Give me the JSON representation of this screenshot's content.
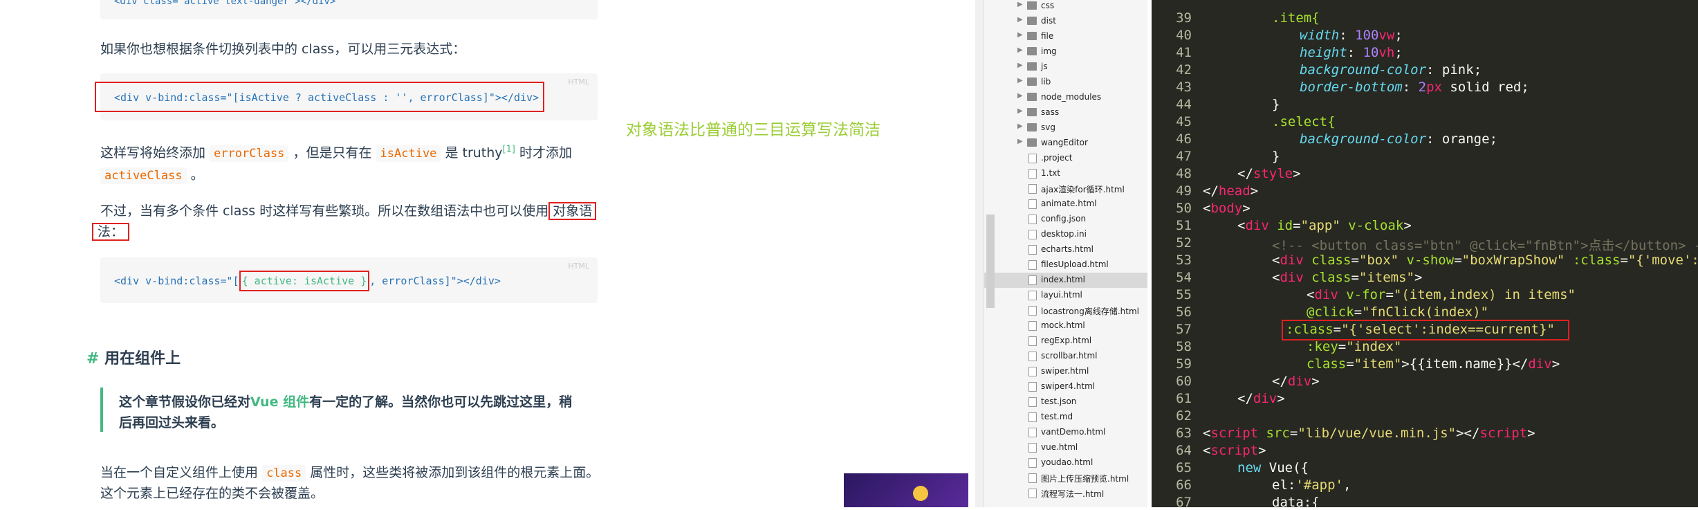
{
  "docs": {
    "top_code": "<div class=\"active text-danger\"></div>",
    "para1": "如果你也想根据条件切换列表中的 class，可以用三元表达式：",
    "code1_lang": "HTML",
    "code1": "<div v-bind:class=\"[isActive ? activeClass : '', errorClass]\"></div>",
    "para2_a": "这样写将始终添加",
    "para2_code1": "errorClass",
    "para2_b": "，但是只有在",
    "para2_code2": "isActive",
    "para2_c": "是 truthy",
    "para2_sup": "[1]",
    "para2_d": "时才添加",
    "para2_code3": "activeClass",
    "para2_e": "。",
    "para3_a": "不过，当有多个条件 class 时这样写有些繁琐。所以在数组语法中也可以使用",
    "para3_boxed1": "对象语",
    "para3_boxed2": "法：",
    "code2_lang": "HTML",
    "code2_pre": "<div v-bind:class=\"[",
    "code2_boxed": "{ active: isActive }",
    "code2_post": ", errorClass]\"></div>",
    "heading_hash": "#",
    "heading": "用在组件上",
    "note_a": "这个章节假设你已经对",
    "note_link": "Vue 组件",
    "note_b": "有一定的了解。当然你也可以先跳过这里，稍",
    "note_c": "后再回过头来看。",
    "para4_a": "当在一个自定义组件上使用",
    "para4_code": "class",
    "para4_b": "属性时，这些类将被添加到该组件的根元素上面。",
    "para4_c": "这个元素上已经存在的类不会被覆盖。",
    "annotation": "对象语法比普通的三目运算写法简洁"
  },
  "file_tree": [
    {
      "label": "css",
      "type": "folder"
    },
    {
      "label": "dist",
      "type": "folder"
    },
    {
      "label": "file",
      "type": "folder"
    },
    {
      "label": "img",
      "type": "folder"
    },
    {
      "label": "js",
      "type": "folder"
    },
    {
      "label": "lib",
      "type": "folder"
    },
    {
      "label": "node_modules",
      "type": "folder"
    },
    {
      "label": "sass",
      "type": "folder"
    },
    {
      "label": "svg",
      "type": "folder"
    },
    {
      "label": "wangEditor",
      "type": "folder"
    },
    {
      "label": ".project",
      "type": "file"
    },
    {
      "label": "1.txt",
      "type": "file"
    },
    {
      "label": "ajax渲染for循环.html",
      "type": "file"
    },
    {
      "label": "animate.html",
      "type": "file"
    },
    {
      "label": "config.json",
      "type": "file"
    },
    {
      "label": "desktop.ini",
      "type": "file"
    },
    {
      "label": "echarts.html",
      "type": "file"
    },
    {
      "label": "filesUpload.html",
      "type": "file"
    },
    {
      "label": "index.html",
      "type": "file",
      "selected": true
    },
    {
      "label": "layui.html",
      "type": "file"
    },
    {
      "label": "locastrong离线存储.html",
      "type": "file"
    },
    {
      "label": "mock.html",
      "type": "file"
    },
    {
      "label": "regExp.html",
      "type": "file"
    },
    {
      "label": "scrollbar.html",
      "type": "file"
    },
    {
      "label": "swiper.html",
      "type": "file"
    },
    {
      "label": "swiper4.html",
      "type": "file"
    },
    {
      "label": "test.json",
      "type": "file"
    },
    {
      "label": "test.md",
      "type": "file"
    },
    {
      "label": "vantDemo.html",
      "type": "file"
    },
    {
      "label": "vue.html",
      "type": "file"
    },
    {
      "label": "youdao.html",
      "type": "file"
    },
    {
      "label": "图片上传压缩预览.html",
      "type": "file"
    },
    {
      "label": "流程写法一.html",
      "type": "file"
    }
  ],
  "editor": {
    "line_numbers": [
      "39",
      "40",
      "41",
      "42",
      "43",
      "44",
      "45",
      "46",
      "47",
      "48",
      "49",
      "50",
      "51",
      "52",
      "53",
      "54",
      "55",
      "56",
      "57",
      "58",
      "59",
      "60",
      "61",
      "62",
      "63",
      "64",
      "65",
      "66",
      "67"
    ],
    "l39": ".item{",
    "l40_p": "width",
    "l40_v": "100",
    "l40_u": "vw",
    "l41_p": "height",
    "l41_v": "10",
    "l41_u": "vh",
    "l42_p": "background-color",
    "l42_v": "pink",
    "l43_p": "border-bottom",
    "l43_v": "2",
    "l43_u": "px",
    "l43_r": "solid red",
    "l44": "}",
    "l45": ".select{",
    "l46_p": "background-color",
    "l46_v": "orange",
    "l47": "}",
    "l48": "style",
    "l49": "head",
    "l50": "body",
    "l51_tag": "div",
    "l51_a1": "id",
    "l51_s1": "\"app\"",
    "l51_a2": "v-cloak",
    "l52": "<!-- <button class=\"btn\" @click=\"fnBtn\">点击</button> -",
    "l53_tag": "div",
    "l53_a1": "class",
    "l53_s1": "\"box\"",
    "l53_a2": "v-show",
    "l53_s2": "\"boxWrapShow\"",
    "l53_a3": ":class",
    "l53_s3": "\"{'move':",
    "l54_tag": "div",
    "l54_a1": "class",
    "l54_s1": "\"items\"",
    "l55_tag": "div",
    "l55_a1": "v-for",
    "l55_s1": "\"(item,index) in items\"",
    "l56_a": "@click",
    "l56_s": "\"fnClick(index)\"",
    "l57_a": ":class",
    "l57_s": "\"{'select':index==current}\"",
    "l58_a": ":key",
    "l58_s": "\"index\"",
    "l59_a": "class",
    "l59_s": "\"item\"",
    "l59_t": "{{item.name}}",
    "l59_tag": "div",
    "l60": "div",
    "l61": "div",
    "l63_tag": "script",
    "l63_a": "src",
    "l63_s": "\"lib/vue/vue.min.js\"",
    "l64": "script",
    "l65_kw": "new",
    "l65_t": "Vue({",
    "l66_p": "el:",
    "l66_s": "'#app'",
    "l67": "data:{"
  },
  "colors": {
    "editor_bg": "#272822",
    "accent_green": "#42b983",
    "highlight_red": "#e02020",
    "annotation_yellow": "#9acd32"
  }
}
